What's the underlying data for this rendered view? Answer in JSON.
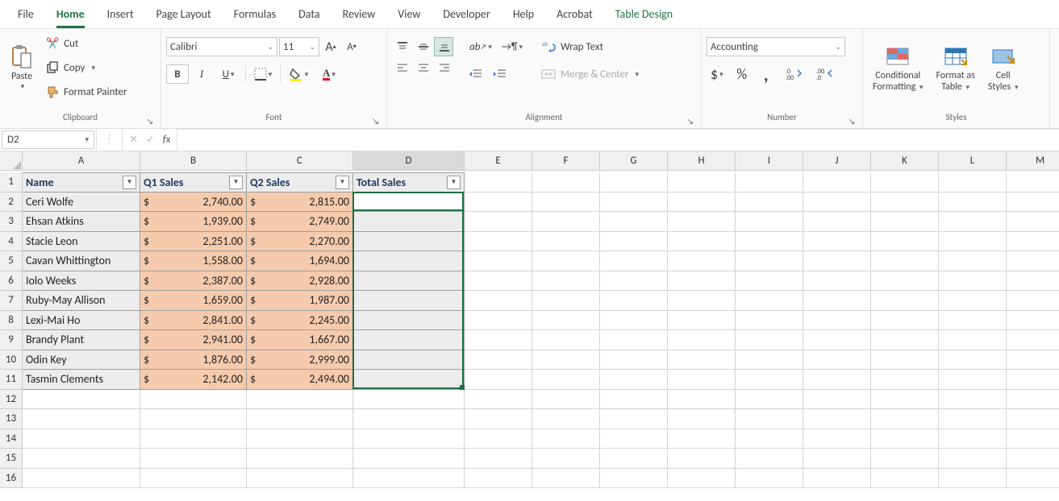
{
  "menu": {
    "items": [
      "File",
      "Home",
      "Insert",
      "Page Layout",
      "Formulas",
      "Data",
      "Review",
      "View",
      "Developer",
      "Help",
      "Acrobat",
      "Table Design"
    ],
    "active": "Home",
    "design": "Table Design"
  },
  "ribbon": {
    "clipboard": {
      "paste": "Paste",
      "cut": "Cut",
      "copy": "Copy",
      "formatPainter": "Format Painter",
      "label": "Clipboard"
    },
    "font": {
      "name": "Calibri",
      "size": "11",
      "bold": "B",
      "italic": "I",
      "underline": "U",
      "label": "Font",
      "growA": "A",
      "shrinkA": "A"
    },
    "alignment": {
      "wrap": "Wrap Text",
      "merge": "Merge & Center",
      "label": "Alignment"
    },
    "number": {
      "format": "Accounting",
      "label": "Number",
      "cur": "$",
      "pct": "%",
      "comma": ",",
      "incdec1": ".0",
      "incdec2": ".00"
    },
    "styles": {
      "cond": "Conditional",
      "cond2": "Formatting",
      "fat": "Format as",
      "fat2": "Table",
      "cs": "Cell",
      "cs2": "Styles",
      "label": "Styles"
    }
  },
  "fbar": {
    "name": "D2",
    "fx": "fx"
  },
  "columns": [
    "A",
    "B",
    "C",
    "D",
    "E",
    "F",
    "G",
    "H",
    "I",
    "J",
    "K",
    "L",
    "M"
  ],
  "table": {
    "headers": [
      "Name",
      "Q1 Sales",
      "Q2 Sales",
      "Total Sales"
    ],
    "rows": [
      {
        "name": "Ceri Wolfe",
        "q1": "2,740.00",
        "q2": "2,815.00"
      },
      {
        "name": "Ehsan Atkins",
        "q1": "1,939.00",
        "q2": "2,749.00"
      },
      {
        "name": "Stacie Leon",
        "q1": "2,251.00",
        "q2": "2,270.00"
      },
      {
        "name": "Cavan Whittington",
        "q1": "1,558.00",
        "q2": "1,694.00"
      },
      {
        "name": "Iolo Weeks",
        "q1": "2,387.00",
        "q2": "2,928.00"
      },
      {
        "name": "Ruby-May Allison",
        "q1": "1,659.00",
        "q2": "1,987.00"
      },
      {
        "name": "Lexi-Mai Ho",
        "q1": "2,841.00",
        "q2": "2,245.00"
      },
      {
        "name": "Brandy Plant",
        "q1": "2,941.00",
        "q2": "1,667.00"
      },
      {
        "name": "Odin Key",
        "q1": "1,876.00",
        "q2": "2,999.00"
      },
      {
        "name": "Tasmin Clements",
        "q1": "2,142.00",
        "q2": "2,494.00"
      }
    ],
    "currency": "$"
  },
  "chart_data": {
    "type": "table",
    "title": "Sales",
    "categories": [
      "Name",
      "Q1 Sales",
      "Q2 Sales",
      "Total Sales"
    ],
    "series": [
      {
        "name": "Q1 Sales",
        "values": [
          2740,
          1939,
          2251,
          1558,
          2387,
          1659,
          2841,
          2941,
          1876,
          2142
        ]
      },
      {
        "name": "Q2 Sales",
        "values": [
          2815,
          2749,
          2270,
          1694,
          2928,
          1987,
          2245,
          1667,
          2999,
          2494
        ]
      }
    ],
    "row_labels": [
      "Ceri Wolfe",
      "Ehsan Atkins",
      "Stacie Leon",
      "Cavan Whittington",
      "Iolo Weeks",
      "Ruby-May Allison",
      "Lexi-Mai Ho",
      "Brandy Plant",
      "Odin Key",
      "Tasmin Clements"
    ]
  }
}
